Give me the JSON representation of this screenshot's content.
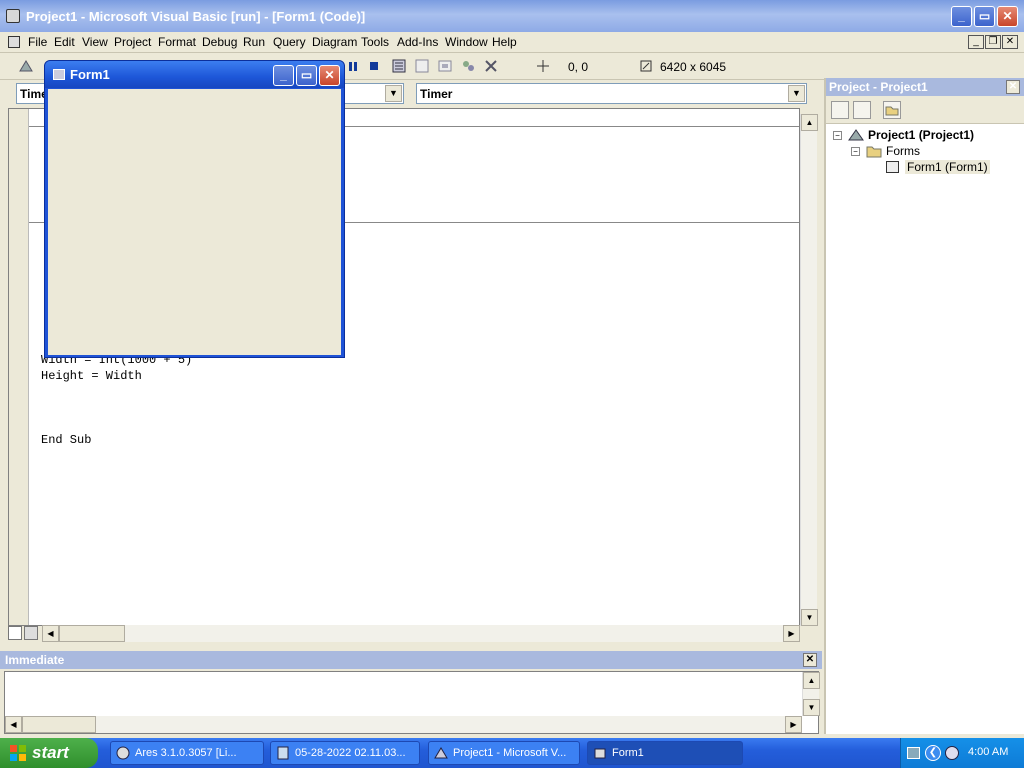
{
  "window": {
    "title": "Project1 - Microsoft Visual Basic [run] - [Form1 (Code)]"
  },
  "menu": [
    "File",
    "Edit",
    "View",
    "Project",
    "Format",
    "Debug",
    "Run",
    "Query",
    "Diagram",
    "Tools",
    "Add-Ins",
    "Window",
    "Help"
  ],
  "toolbar": {
    "position": "0, 0",
    "size": "6420 x 6045"
  },
  "code": {
    "object_combo": "Timer",
    "proc_combo": "Timer",
    "lines": [
      "Width = Int(1000 + 5)",
      "Height = Width",
      "End Sub"
    ]
  },
  "form1": {
    "title": "Form1"
  },
  "project": {
    "title": "Project - Project1",
    "root": "Project1 (Project1)",
    "folder": "Forms",
    "item": "Form1 (Form1)"
  },
  "immediate": {
    "title": "Immediate"
  },
  "taskbar": {
    "start": "start",
    "tasks": [
      "Ares 3.1.0.3057  [Li...",
      "05-28-2022 02.11.03...",
      "Project1 - Microsoft V...",
      "Form1"
    ],
    "time": "4:00 AM"
  }
}
